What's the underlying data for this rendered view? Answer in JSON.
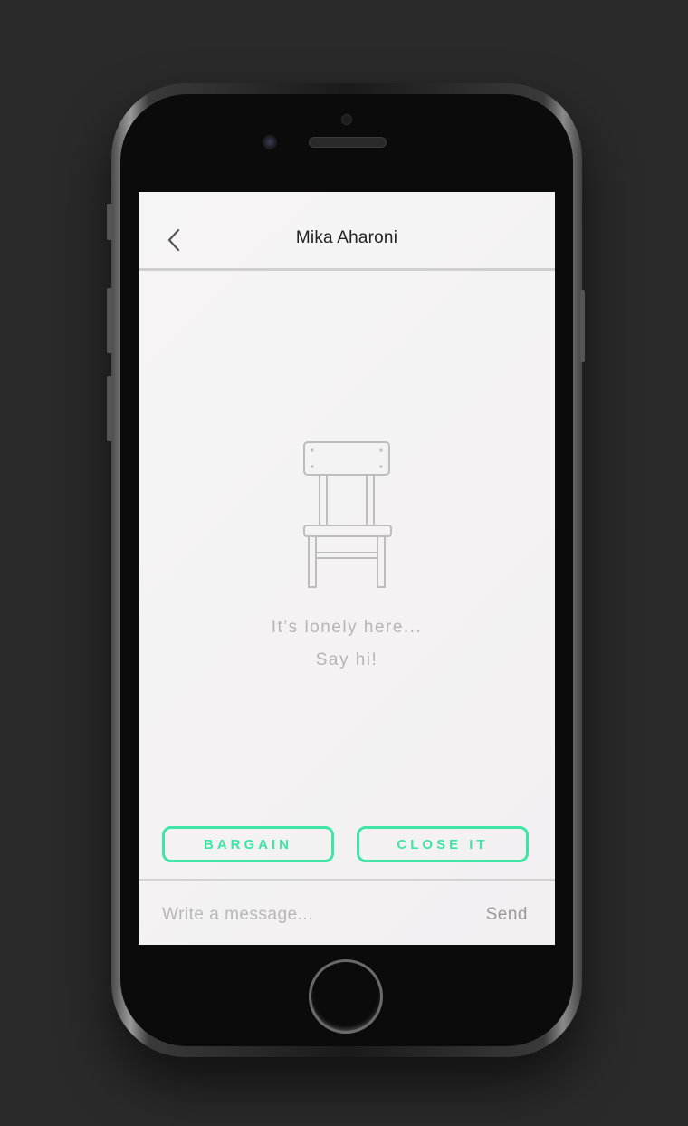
{
  "chat": {
    "contact_name": "Mika Aharoni",
    "back_icon": "chevron-left-icon"
  },
  "empty_state": {
    "icon": "chair-icon",
    "line1": "It’s lonely here...",
    "line2": "Say hi!"
  },
  "actions": {
    "bargain_label": "BARGAIN",
    "close_label": "CLOSE IT",
    "accent_color": "#3ee5a4"
  },
  "composer": {
    "placeholder": "Write a message...",
    "send_label": "Send"
  }
}
